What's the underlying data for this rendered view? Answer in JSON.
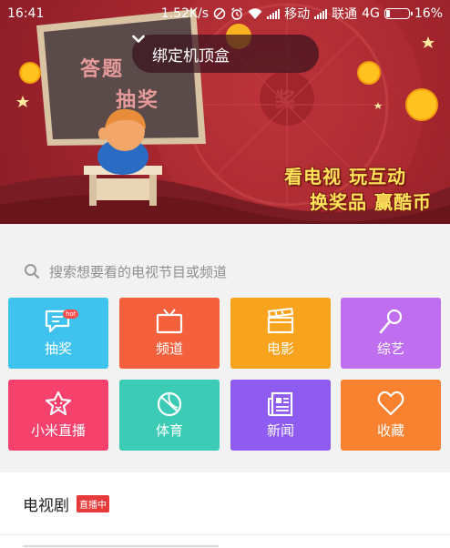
{
  "status_bar": {
    "time": "16:41",
    "net_speed": "1.52K/s",
    "carrier1": "移动",
    "carrier2": "联通",
    "network": "4G",
    "battery": "16%",
    "battery_level": 0.16
  },
  "banner": {
    "board_line1": "答题",
    "board_line2": "抽奖",
    "wheel_text": "奖",
    "slogan_line1": "看电视 玩互动",
    "slogan_line2": "换奖品 赢酷币",
    "device_selector": "绑定机顶盒"
  },
  "search": {
    "placeholder": "搜索想要看的电视节目或频道"
  },
  "tiles": [
    {
      "label": "抽奖",
      "color": "#3fc3ee",
      "icon": "lottery-chat-icon",
      "badge": "hot"
    },
    {
      "label": "频道",
      "color": "#f4603c",
      "icon": "tv-icon"
    },
    {
      "label": "电影",
      "color": "#f8a31e",
      "icon": "clapperboard-icon"
    },
    {
      "label": "综艺",
      "color": "#bf6ef0",
      "icon": "microphone-icon"
    },
    {
      "label": "小米直播",
      "color": "#f5416c",
      "icon": "star-face-icon"
    },
    {
      "label": "体育",
      "color": "#3ccbb5",
      "icon": "ball-icon"
    },
    {
      "label": "新闻",
      "color": "#8e5cf0",
      "icon": "newspaper-icon"
    },
    {
      "label": "收藏",
      "color": "#f98230",
      "icon": "heart-icon"
    }
  ],
  "section": {
    "title": "电视剧",
    "badge": "直播中"
  }
}
